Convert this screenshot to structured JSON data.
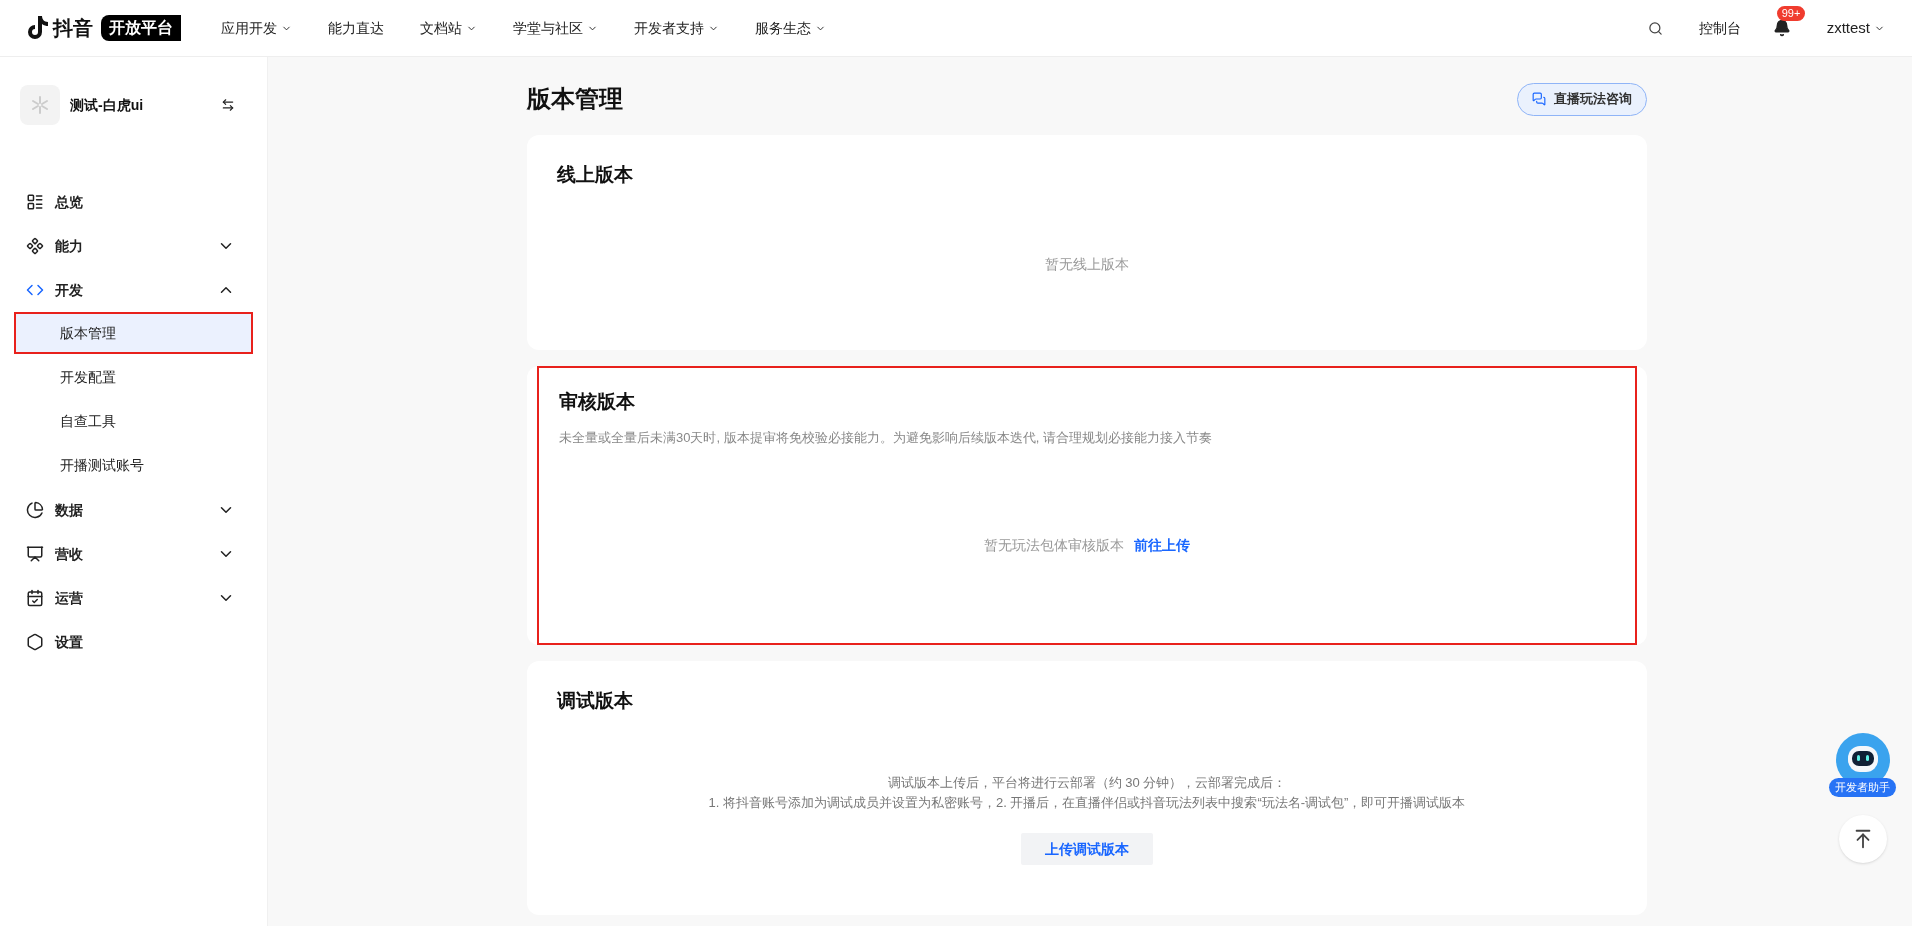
{
  "header": {
    "logo": {
      "name": "抖音",
      "tag": "开放平台"
    },
    "nav": [
      {
        "label": "应用开发",
        "has_menu": true
      },
      {
        "label": "能力直达",
        "has_menu": false
      },
      {
        "label": "文档站",
        "has_menu": true
      },
      {
        "label": "学堂与社区",
        "has_menu": true
      },
      {
        "label": "开发者支持",
        "has_menu": true
      },
      {
        "label": "服务生态",
        "has_menu": true
      }
    ],
    "console": "控制台",
    "notification_badge": "99+",
    "user": "zxttest"
  },
  "sidebar": {
    "app_name": "测试-白虎ui",
    "items": [
      {
        "kind": "link",
        "label": "总览",
        "selected": false
      },
      {
        "kind": "group",
        "label": "能力",
        "expanded": false,
        "selected": false
      },
      {
        "kind": "group",
        "label": "开发",
        "expanded": true,
        "selected": true,
        "children": [
          {
            "label": "版本管理",
            "selected": true,
            "highlighted": true
          },
          {
            "label": "开发配置",
            "selected": false,
            "highlighted": false
          },
          {
            "label": "自查工具",
            "selected": false,
            "highlighted": false
          },
          {
            "label": "开播测试账号",
            "selected": false,
            "highlighted": false
          }
        ]
      },
      {
        "kind": "group",
        "label": "数据",
        "expanded": false,
        "selected": false
      },
      {
        "kind": "group",
        "label": "营收",
        "expanded": false,
        "selected": false
      },
      {
        "kind": "group",
        "label": "运营",
        "expanded": false,
        "selected": false
      },
      {
        "kind": "link",
        "label": "设置",
        "selected": false
      }
    ]
  },
  "page": {
    "title": "版本管理",
    "consult_button": "直播玩法咨询",
    "sections": [
      {
        "kind": "online",
        "title": "线上版本",
        "empty": "暂无线上版本",
        "highlighted": false
      },
      {
        "kind": "review",
        "title": "审核版本",
        "note": "未全量或全量后未满30天时, 版本提审将免校验必接能力。为避免影响后续版本迭代, 请合理规划必接能力接入节奏",
        "empty": "暂无玩法包体审核版本",
        "link": "前往上传",
        "highlighted": true
      },
      {
        "kind": "debug",
        "title": "调试版本",
        "lines": [
          "调试版本上传后，平台将进行云部署（约 30 分钟），云部署完成后：",
          "1. 将抖音账号添加为调试成员并设置为私密账号，2. 开播后，在直播伴侣或抖音玩法列表中搜索“玩法名-调试包”，即可开播调试版本"
        ],
        "button": "上传调试版本",
        "highlighted": false
      }
    ]
  },
  "assistant": {
    "label": "开发者助手"
  }
}
